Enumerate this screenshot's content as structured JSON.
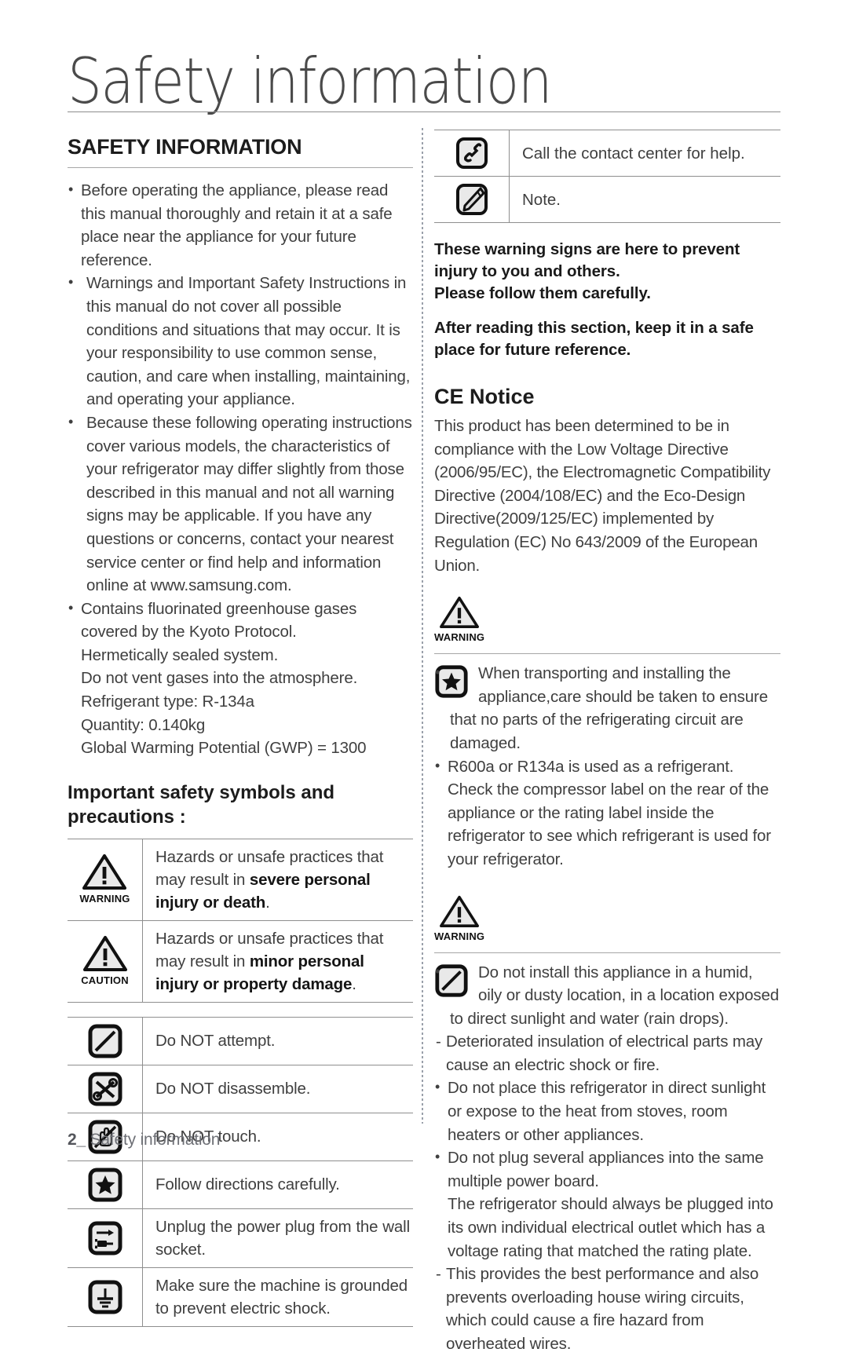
{
  "document": {
    "title": "Safety information",
    "footer": {
      "page_number": "2",
      "separator": "_",
      "section": "Safety information"
    }
  },
  "left_column": {
    "section_heading": "SAFETY INFORMATION",
    "bullets": [
      "Before operating the appliance, please read this manual thoroughly and retain it at a safe place near the appliance for your future reference.",
      "Warnings and Important Safety Instructions in this manual do not cover all possible conditions and situations that may occur. It is your responsibility to use common sense, caution, and care when installing, maintaining, and operating your appliance.",
      "Because these following operating instructions cover various models, the characteristics of your refrigerator may differ slightly from those described in this manual and not all warning signs may be applicable. If you have any questions or concerns, contact your nearest service center or find help and information online at www.samsung.com."
    ],
    "gas_bullet": "Contains fluorinated greenhouse gases covered by the Kyoto Protocol.",
    "gas_lines": [
      "Hermetically sealed system.",
      "Do not vent gases into the atmosphere.",
      "Refrigerant type: R-134a",
      "Quantity: 0.140kg",
      "Global Warming Potential (GWP) = 1300"
    ],
    "symbols_heading": "Important safety symbols and precautions :",
    "severity_rows": [
      {
        "icon": "warning-triangle-icon",
        "icon_label": "WARNING",
        "text_plain": "Hazards or unsafe practices that may result in ",
        "text_bold": "severe personal injury or death",
        "text_tail": "."
      },
      {
        "icon": "caution-triangle-icon",
        "icon_label": "CAUTION",
        "text_plain": "Hazards or unsafe practices that may result in ",
        "text_bold": "minor personal injury or property damage",
        "text_tail": "."
      }
    ],
    "symbol_rows": [
      {
        "icon": "do-not-attempt-icon",
        "text": "Do NOT attempt."
      },
      {
        "icon": "do-not-disassemble-icon",
        "text": "Do NOT disassemble."
      },
      {
        "icon": "do-not-touch-icon",
        "text": "Do NOT touch."
      },
      {
        "icon": "follow-directions-star-icon",
        "text": "Follow directions carefully."
      },
      {
        "icon": "unplug-power-plug-icon",
        "text": "Unplug the power plug from the wall socket."
      },
      {
        "icon": "grounding-icon",
        "text": "Make sure the machine is grounded to prevent electric shock."
      }
    ]
  },
  "right_column": {
    "info_rows": [
      {
        "icon": "phone-call-icon",
        "text": "Call the contact center for help."
      },
      {
        "icon": "note-pen-icon",
        "text": "Note."
      }
    ],
    "bold_notice": {
      "paragraph_1_line_1": "These warning signs are here to prevent",
      "paragraph_1_line_2": "injury to you and others.",
      "paragraph_1_line_3": "Please follow them carefully.",
      "paragraph_2_line_1": "After reading this section, keep it in a safe",
      "paragraph_2_line_2": "place for future reference."
    },
    "ce_notice": {
      "heading": "CE Notice",
      "body": "This product has been determined to be in compliance with the Low Voltage Directive (2006/95/EC), the Electromagnetic Compatibility Directive (2004/108/EC) and the Eco-Design Directive(2009/125/EC) implemented by Regulation (EC) No 643/2009 of the European Union."
    },
    "warning_block_1": {
      "icon": "warning-triangle-icon",
      "icon_label": "WARNING",
      "inline_icon": "follow-directions-star-icon",
      "bullet_1": "When transporting and installing the appliance,care should be taken to ensure that no parts of the refrigerating circuit are damaged.",
      "bullet_2": "R600a or R134a is used as a refrigerant. Check the compressor label on the rear of the appliance or the rating label inside the refrigerator to see which refrigerant is used for your refrigerator."
    },
    "warning_block_2": {
      "icon": "warning-triangle-icon",
      "icon_label": "WARNING",
      "inline_icon": "do-not-attempt-icon",
      "bullet_1": "Do not install this appliance in a humid, oily or dusty location, in a location exposed to direct sunlight and water (rain drops).",
      "dash_1": "Deteriorated insulation of electrical parts may cause an electric shock or fire.",
      "bullet_2": "Do not place this refrigerator in direct sunlight or expose to the heat from stoves, room heaters or other appliances.",
      "bullet_3": "Do not plug several appliances into the same multiple power board.",
      "bullet_3_cont": "The refrigerator should always be plugged into its own individual electrical outlet which has a voltage rating that matched the rating plate.",
      "dash_2": "This provides the best performance and also prevents overloading house wiring circuits, which could cause a fire hazard from overheated wires."
    }
  },
  "colors": {
    "text": "#3f3f3f",
    "heading": "#1c1c1c",
    "rule": "#8e8e8e",
    "footer": "#6e7076",
    "icon_fill": "#e8e8e8",
    "icon_stroke": "#1a1a1a"
  }
}
